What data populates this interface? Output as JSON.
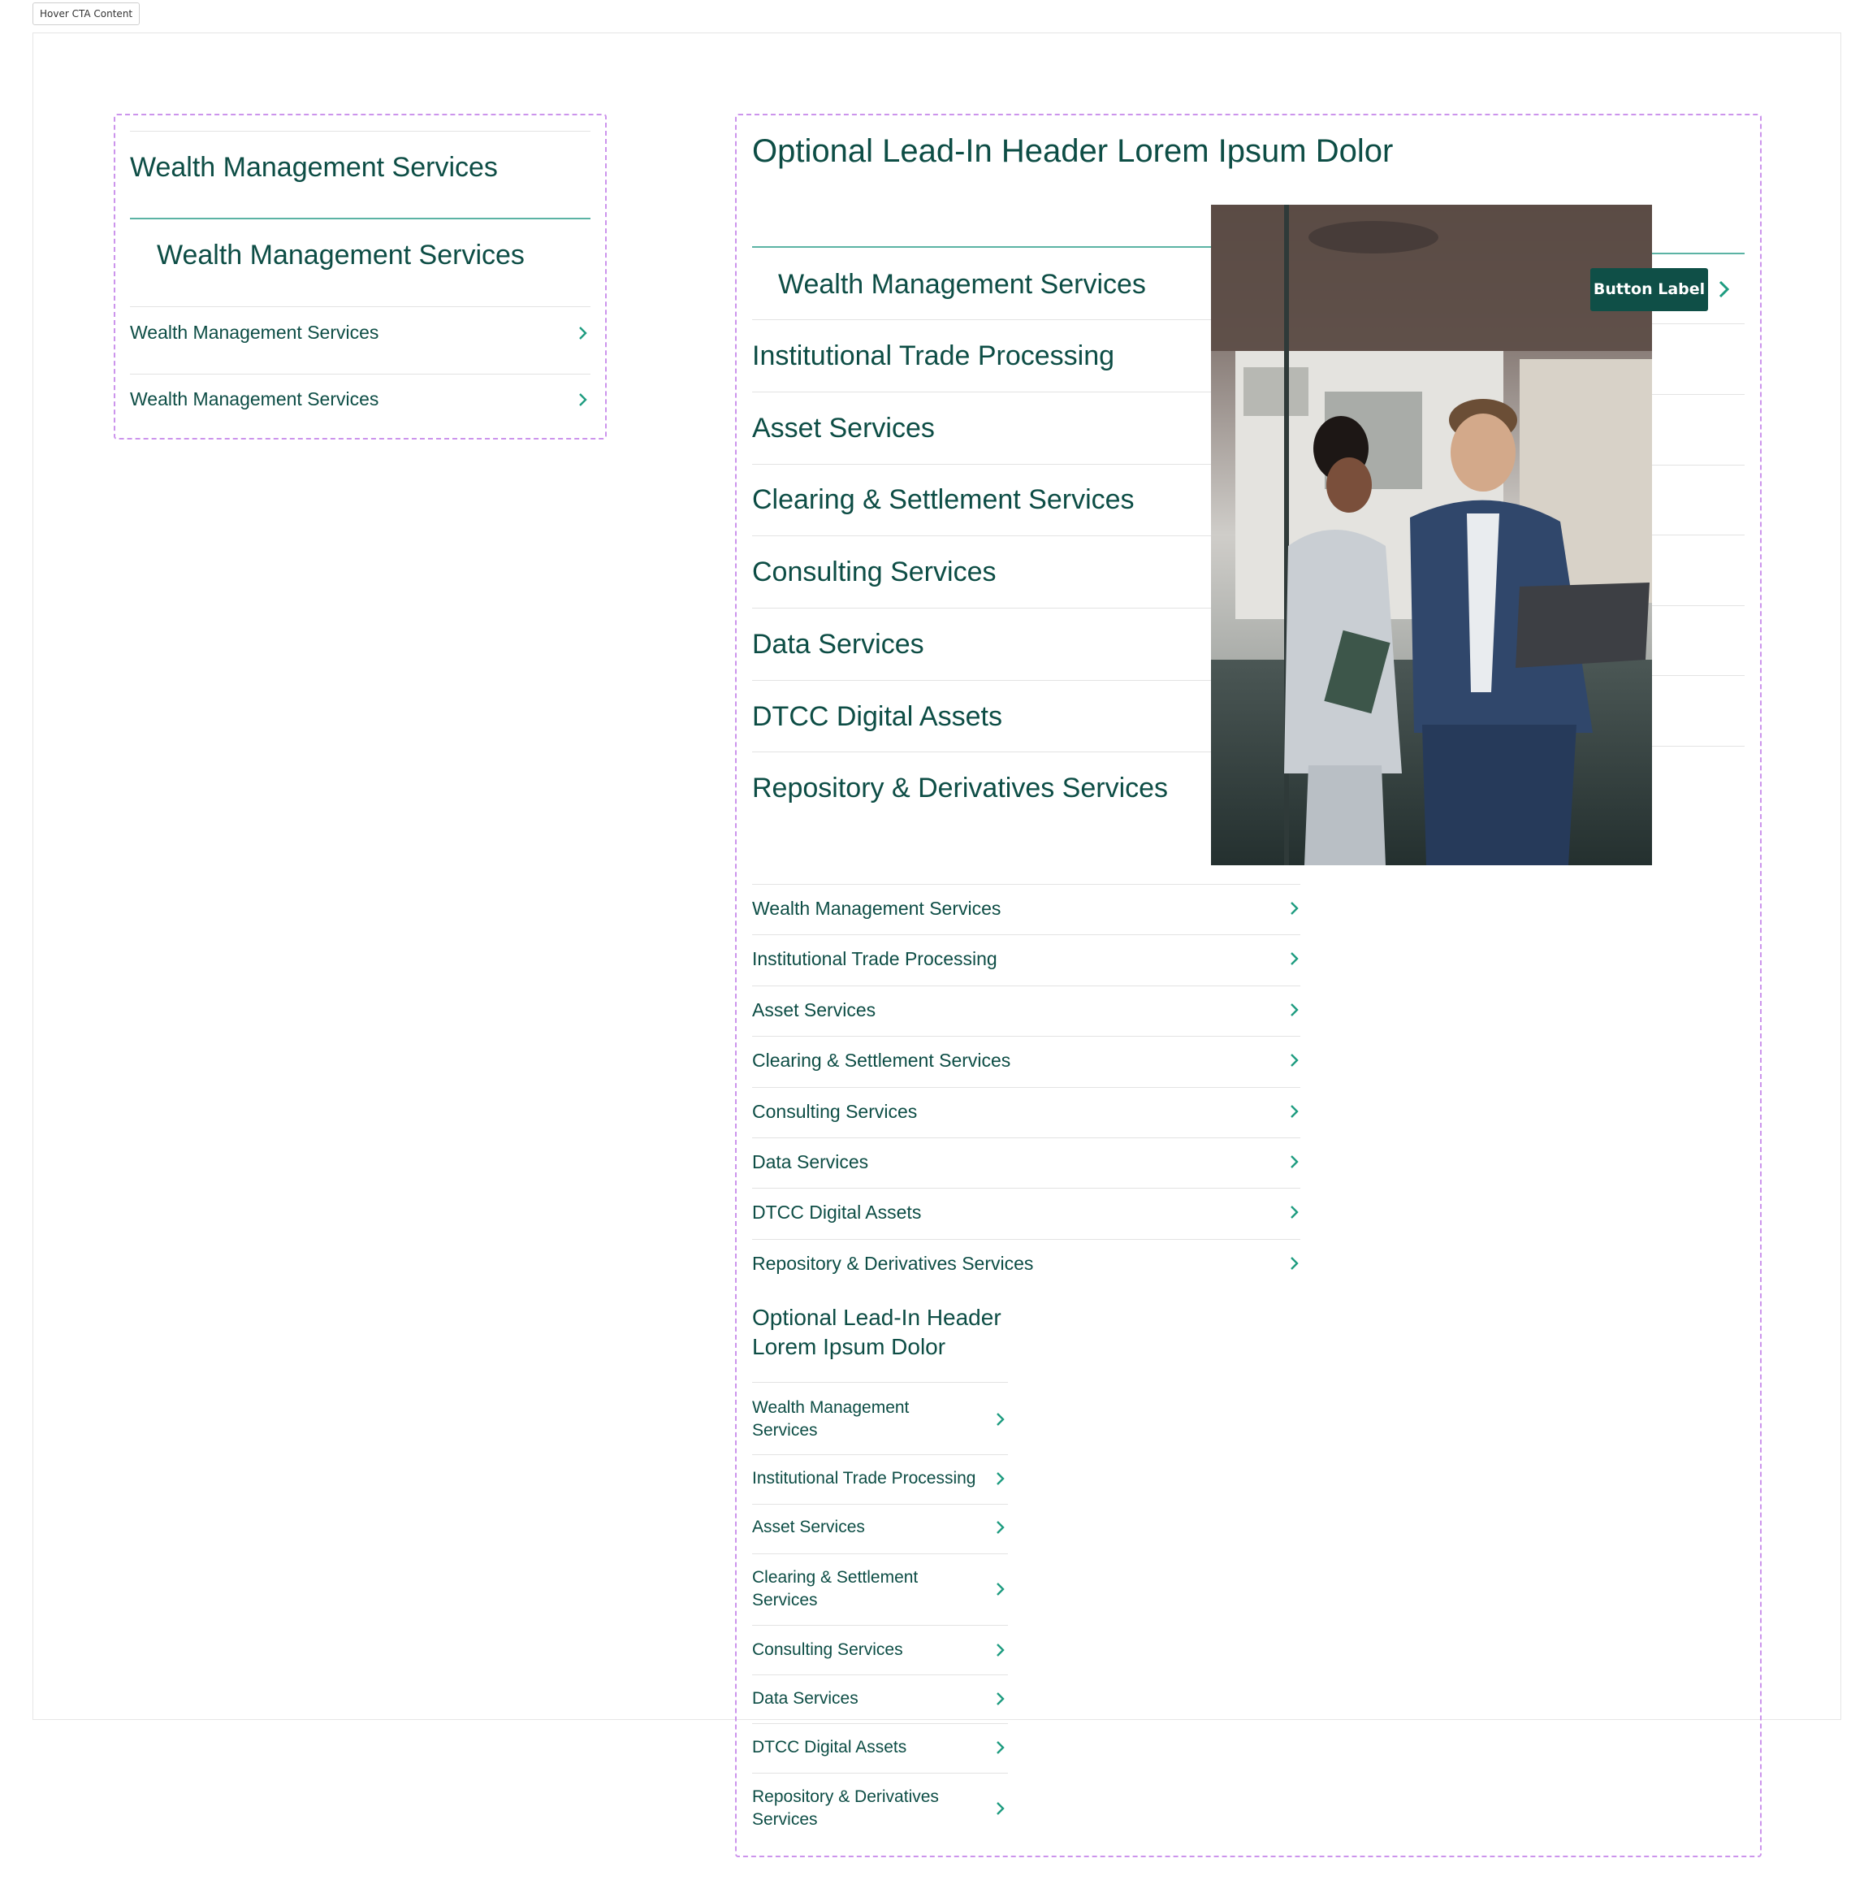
{
  "storybook": {
    "tab_label": "Hover CTA Content"
  },
  "colors": {
    "accent": "#0d4d45",
    "chevron": "#1e9c80",
    "dashed": "#cc94ec",
    "button_bg": "#0f4f47"
  },
  "left_panel": {
    "heading": "Wealth Management Services",
    "heading_indented": "Wealth Management Services",
    "links": [
      {
        "label": "Wealth Management Services",
        "icon": "chevron-right-icon"
      },
      {
        "label": "Wealth Management Services",
        "icon": "chevron-right-icon"
      }
    ]
  },
  "right_panel": {
    "lead_in": "Optional Lead-In Header Lorem Ipsum Dolor",
    "hover_item": "Wealth Management Services",
    "cta_button_label": "Button Label",
    "large_items": [
      "Institutional Trade Processing",
      "Asset Services",
      "Clearing & Settlement Services",
      "Consulting Services",
      "Data Services",
      "DTCC Digital Assets",
      "Repository & Derivatives Services"
    ],
    "image_alt": "photo-two-colleagues-in-office",
    "medium_links": [
      "Wealth Management Services",
      "Institutional Trade Processing",
      "Asset Services",
      "Clearing & Settlement Services",
      "Consulting Services",
      "Data Services",
      "DTCC Digital Assets",
      "Repository & Derivatives Services"
    ],
    "narrow_block": {
      "lead_in_line1": "Optional Lead-In Header",
      "lead_in_line2": "Lorem Ipsum Dolor",
      "links": [
        [
          "Wealth Management",
          "Services"
        ],
        [
          "Institutional Trade Processing"
        ],
        [
          "Asset Services"
        ],
        [
          "Clearing & Settlement",
          "Services"
        ],
        [
          "Consulting Services"
        ],
        [
          "Data Services"
        ],
        [
          "DTCC Digital Assets"
        ],
        [
          "Repository & Derivatives",
          "Services"
        ]
      ]
    }
  }
}
